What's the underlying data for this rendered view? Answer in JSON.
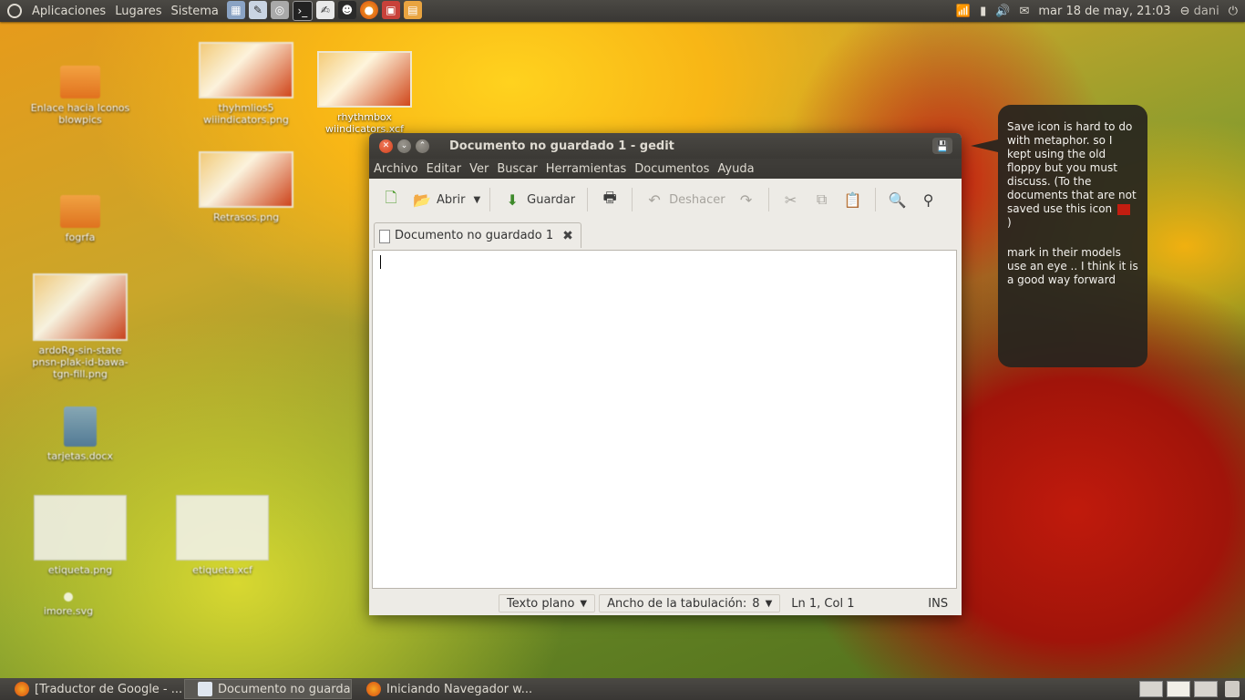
{
  "top_panel": {
    "menus": [
      "Aplicaciones",
      "Lugares",
      "Sistema"
    ],
    "clock": "mar 18 de may, 21:03",
    "user": "dani",
    "launchers": [
      "calculator-icon",
      "text-editor-icon",
      "disk-icon",
      "terminal-icon",
      "notes-icon",
      "tux-icon",
      "firefox-icon",
      "screenshot-icon",
      "archive-icon"
    ],
    "tray": [
      "wifi-icon",
      "battery-icon",
      "volume-icon",
      "mail-icon"
    ]
  },
  "desktop": {
    "icons": [
      {
        "label": "Enlace hacia Iconos blowpics",
        "kind": "folder"
      },
      {
        "label": "thyhmlios5 wiiindicators.png",
        "kind": "thumb"
      },
      {
        "label": "rhythmbox wiindicators.xcf",
        "kind": "thumb"
      },
      {
        "label": "Retrasos.png",
        "kind": "thumb"
      },
      {
        "label": "fogrfa",
        "kind": "folder"
      },
      {
        "label": "ardoRg-sin-state pnsn-plak-id-bawa-tgn-fill.png",
        "kind": "thumb"
      },
      {
        "label": "tarjetas.docx",
        "kind": "doc"
      },
      {
        "label": "etiqueta.png",
        "kind": "paper"
      },
      {
        "label": "etiqueta.xcf",
        "kind": "paper"
      },
      {
        "label": "imore.svg",
        "kind": "dot"
      }
    ]
  },
  "window": {
    "title": "Documento no guardado 1 - gedit",
    "menus": [
      "Archivo",
      "Editar",
      "Ver",
      "Buscar",
      "Herramientas",
      "Documentos",
      "Ayuda"
    ],
    "toolbar": {
      "new": "",
      "open": "Abrir",
      "save": "Guardar",
      "undo": "Deshacer"
    },
    "tab_label": "Documento no guardado 1",
    "status": {
      "mode": "Texto plano",
      "tab_width": "Ancho de la tabulación:",
      "tab_width_value": "8",
      "position": "Ln 1, Col 1",
      "insert": "INS"
    }
  },
  "bubble": {
    "para1_a": "Save icon is hard to do with metaphor. so I kept using the old floppy but you must discuss. (To the documents that are not saved use this icon",
    "para1_b": ")",
    "para2": "mark in their models use an eye .. I think it is a good way forward"
  },
  "taskbar": {
    "items": [
      {
        "label": "[Traductor de Google - ...",
        "active": false
      },
      {
        "label": "Documento no guarda...",
        "active": true
      },
      {
        "label": "Iniciando Navegador w...",
        "active": false
      }
    ]
  },
  "colors": {
    "panel": "#3c3a36",
    "close_button": "#d1401c",
    "bubble": "#26241e"
  }
}
